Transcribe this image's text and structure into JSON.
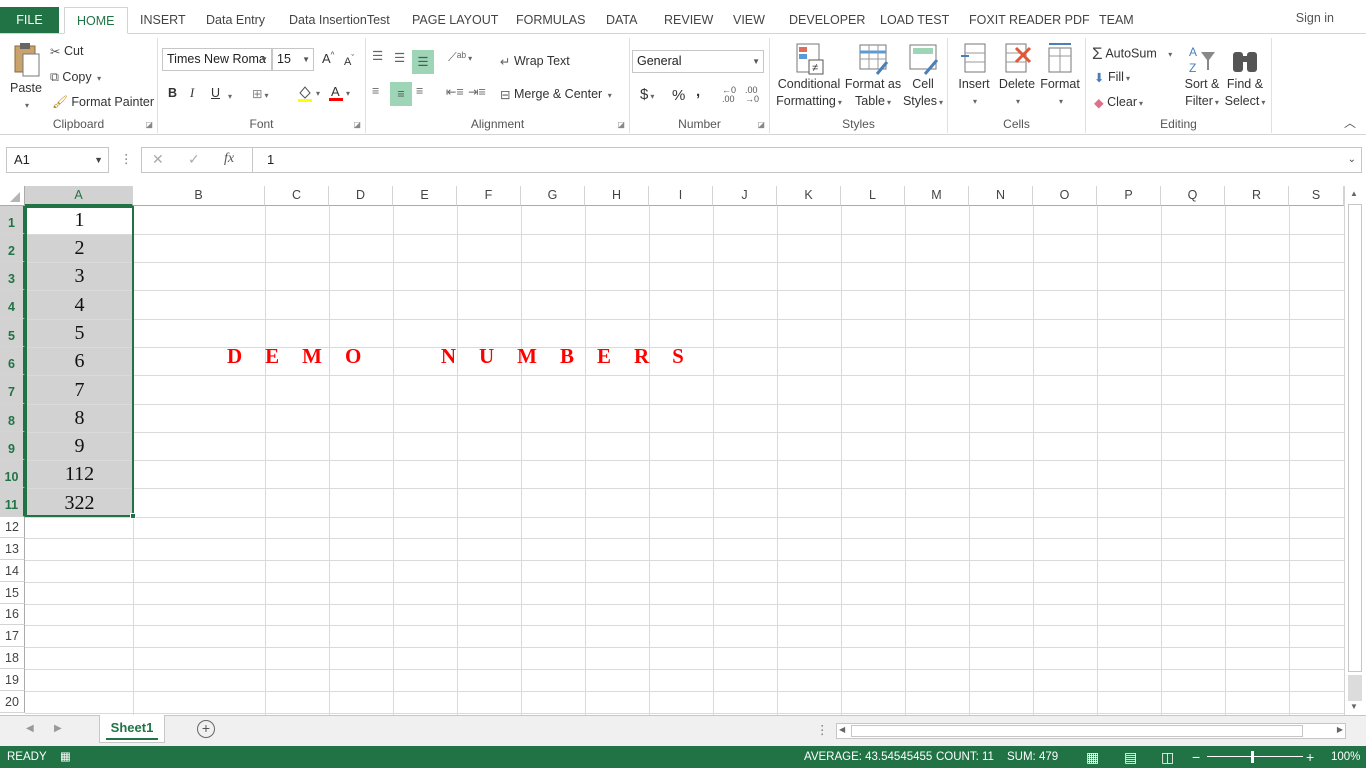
{
  "tabs": {
    "file": "FILE",
    "home": "HOME",
    "insert": "INSERT",
    "data_entry": "Data Entry",
    "data_insertion_test": "Data InsertionTest",
    "page_layout": "PAGE LAYOUT",
    "formulas": "FORMULAS",
    "data": "DATA",
    "review": "REVIEW",
    "view": "VIEW",
    "developer": "DEVELOPER",
    "load_test": "LOAD TEST",
    "foxit": "FOXIT READER PDF",
    "team": "TEAM"
  },
  "sign_in": "Sign in",
  "clipboard": {
    "paste": "Paste",
    "cut": "Cut",
    "copy": "Copy",
    "format_painter": "Format Painter",
    "label": "Clipboard"
  },
  "font": {
    "name": "Times New Roma",
    "size": "15",
    "bold": "B",
    "italic": "I",
    "underline": "U",
    "label": "Font"
  },
  "alignment": {
    "wrap_text": "Wrap Text",
    "merge_center": "Merge & Center",
    "label": "Alignment"
  },
  "number": {
    "format": "General",
    "currency": "$",
    "percent": "%",
    "comma": ",",
    "label": "Number"
  },
  "styles": {
    "conditional_1": "Conditional",
    "conditional_2": "Formatting",
    "format_table_1": "Format as",
    "format_table_2": "Table",
    "cell_styles_1": "Cell",
    "cell_styles_2": "Styles",
    "label": "Styles"
  },
  "cells": {
    "insert": "Insert",
    "delete": "Delete",
    "format": "Format",
    "label": "Cells"
  },
  "editing": {
    "autosum": "AutoSum",
    "fill": "Fill",
    "clear": "Clear",
    "sort_1": "Sort &",
    "sort_2": "Filter",
    "find_1": "Find &",
    "find_2": "Select",
    "label": "Editing"
  },
  "formula_bar": {
    "name_box": "A1",
    "fx": "fx",
    "value": "1"
  },
  "columns": [
    "A",
    "B",
    "C",
    "D",
    "E",
    "F",
    "G",
    "H",
    "I",
    "J",
    "K",
    "L",
    "M",
    "N",
    "O",
    "P",
    "Q",
    "R",
    "S"
  ],
  "rows": [
    "1",
    "2",
    "3",
    "4",
    "5",
    "6",
    "7",
    "8",
    "9",
    "10",
    "11",
    "12",
    "13",
    "14",
    "15",
    "16",
    "17",
    "18",
    "19",
    "20"
  ],
  "column_a_values": [
    "1",
    "2",
    "3",
    "4",
    "5",
    "6",
    "7",
    "8",
    "9",
    "112",
    "322"
  ],
  "demo_text": "DEMO  NUMBERS",
  "sheet_tab": "Sheet1",
  "status": {
    "ready": "READY",
    "average": "AVERAGE: 43.54545455",
    "count": "COUNT: 11",
    "sum": "SUM: 479",
    "zoom": "100%"
  },
  "colors": {
    "accent": "#217346",
    "demo_text": "#ff0000",
    "selection_fill": "#d2d2d2"
  }
}
